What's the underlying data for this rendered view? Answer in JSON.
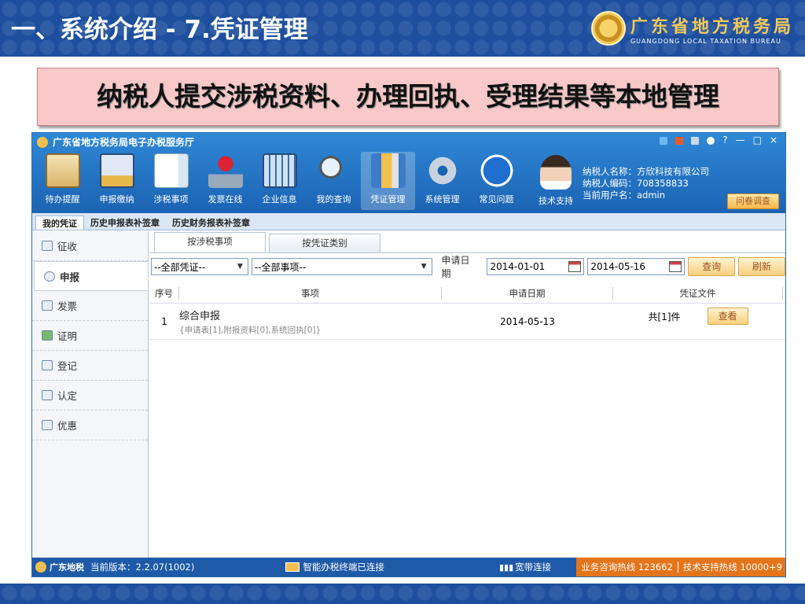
{
  "slide": {
    "title": "一、系统介绍 - 7.凭证管理",
    "org_name_cn": "广东省地方税务局",
    "org_name_en": "GUANGDONG LOCAL TAXATION BUREAU",
    "callout": "纳税人提交涉税资料、办理回执、受理结果等本地管理"
  },
  "app": {
    "title": "广东省地方税务局电子办税服务厅",
    "window_controls": [
      "?",
      "—",
      "□",
      "×"
    ],
    "toolbar": [
      {
        "label": "待办提醒",
        "icon": "clipboard-icon"
      },
      {
        "label": "申报缴纳",
        "icon": "monitor-coin-icon"
      },
      {
        "label": "涉税事项",
        "icon": "document-arrow-icon"
      },
      {
        "label": "发票在线",
        "icon": "stamp-icon"
      },
      {
        "label": "企业信息",
        "icon": "building-icon"
      },
      {
        "label": "我的查询",
        "icon": "magnifier-icon"
      },
      {
        "label": "凭证管理",
        "icon": "binders-icon",
        "active": true
      },
      {
        "label": "系统管理",
        "icon": "gear-icon"
      },
      {
        "label": "常见问题",
        "icon": "question-icon"
      },
      {
        "label": "技术支持",
        "icon": "support-agent-icon"
      }
    ],
    "taxpayer": {
      "name": "纳税人名称：方欣科技有限公司",
      "code": "纳税人编码：708358833",
      "user": "当前用户名：admin"
    },
    "survey_button": "问卷调查",
    "tabs": [
      "我的凭证",
      "历史申报表补签章",
      "历史财务报表补签章"
    ],
    "sidebar": [
      "征收",
      "申报",
      "发票",
      "证明",
      "登记",
      "认定",
      "优惠"
    ],
    "subtabs": [
      "按涉税事项",
      "按凭证类别"
    ],
    "filters": {
      "voucher_select": "--全部凭证--",
      "item_select": "--全部事项--",
      "date_label": "申请日期",
      "date_from": "2014-01-01",
      "date_to": "2014-05-16",
      "query_button": "查询",
      "refresh_button": "刷新"
    },
    "table": {
      "headers": [
        "序号",
        "事项",
        "申请日期",
        "凭证文件"
      ],
      "rows": [
        {
          "index": "1",
          "title": "综合申报",
          "detail": "{申请表[1],附报资料[0],系统回执[0]}",
          "date": "2014-05-13",
          "files": "共[1]件",
          "action": "查看"
        }
      ]
    },
    "statusbar": {
      "brand": "广东地税",
      "version": "当前版本：2.2.07(1002)",
      "terminal": "智能办税终端已连接",
      "network": "宽带连接",
      "hotline_business": "业务咨询热线 123662",
      "hotline_tech": "技术支持热线 10000+9"
    }
  }
}
